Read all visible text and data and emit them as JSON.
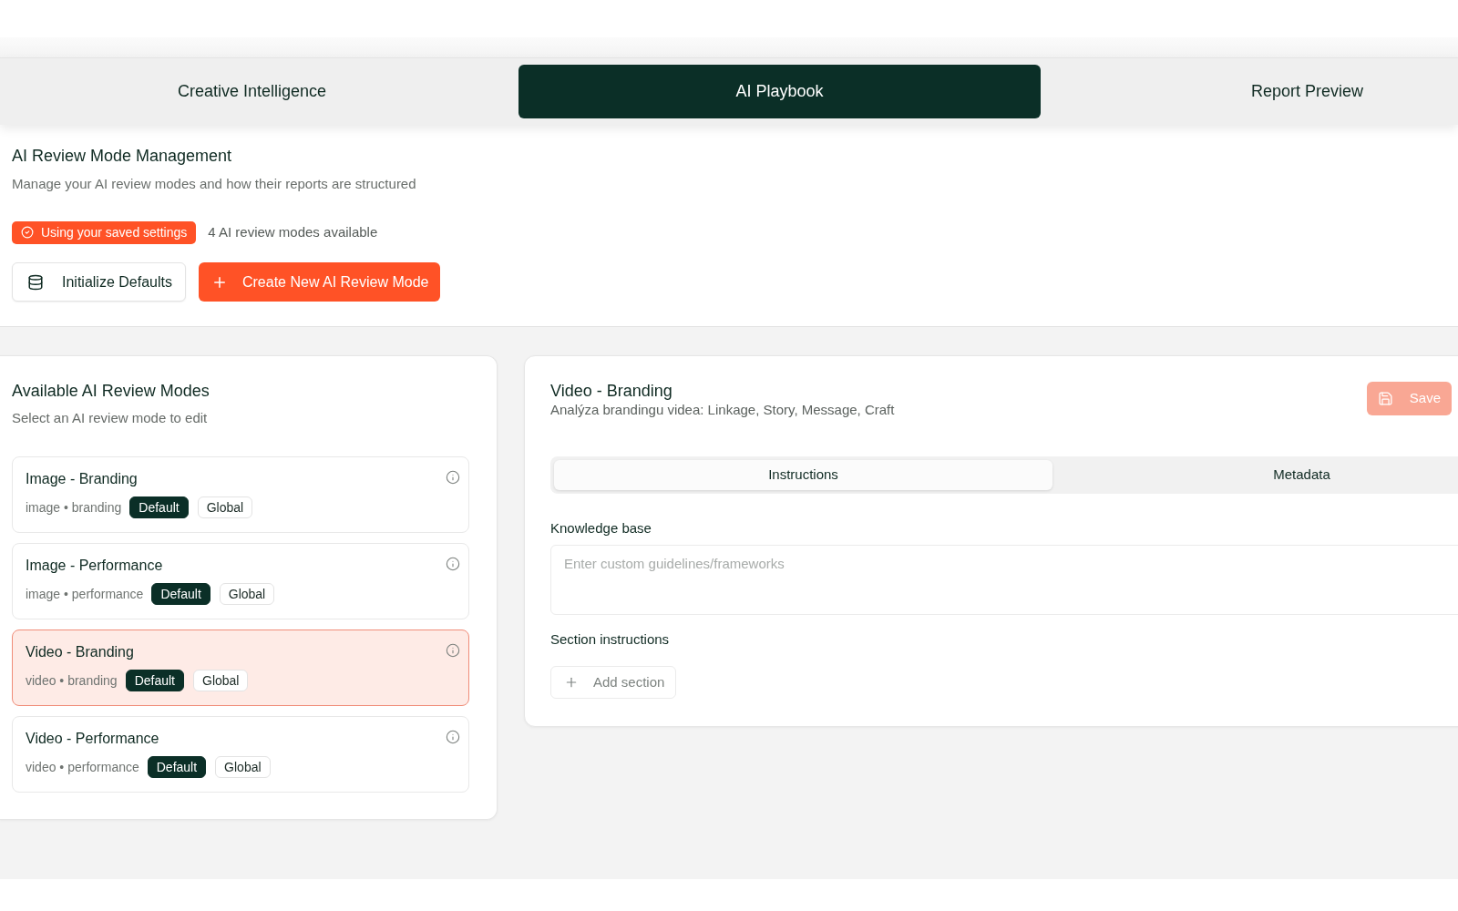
{
  "tabs": [
    {
      "label": "Creative Intelligence",
      "selected": false
    },
    {
      "label": "AI Playbook",
      "selected": true
    },
    {
      "label": "Report Preview",
      "selected": false
    }
  ],
  "header": {
    "title": "AI Review Mode Management",
    "subtitle": "Manage your AI review modes and how their reports are structured",
    "status_badge": "Using your saved settings",
    "mode_count": "4 AI review modes available",
    "buttons": [
      {
        "label": "Initialize Defaults",
        "kind": "secondary"
      },
      {
        "label": "Create New AI Review Mode",
        "kind": "primary"
      }
    ]
  },
  "modes_panel": {
    "title": "Available AI Review Modes",
    "subtitle": "Select an AI review mode to edit",
    "modes": [
      {
        "name": "Image - Branding",
        "meta": "image • branding",
        "selected": false,
        "badges": [
          {
            "label": "Default",
            "kind": "filled"
          },
          {
            "label": "Global",
            "kind": "outlined"
          }
        ]
      },
      {
        "name": "Image - Performance",
        "meta": "image • performance",
        "selected": false,
        "badges": [
          {
            "label": "Default",
            "kind": "filled"
          },
          {
            "label": "Global",
            "kind": "outlined"
          }
        ]
      },
      {
        "name": "Video - Branding",
        "meta": "video • branding",
        "selected": true,
        "badges": [
          {
            "label": "Default",
            "kind": "filled"
          },
          {
            "label": "Global",
            "kind": "outlined"
          }
        ]
      },
      {
        "name": "Video - Performance",
        "meta": "video • performance",
        "selected": false,
        "badges": [
          {
            "label": "Default",
            "kind": "filled"
          },
          {
            "label": "Global",
            "kind": "outlined"
          }
        ]
      }
    ]
  },
  "editor": {
    "title": "Video - Branding",
    "description": "Analýza brandingu videa: Linkage, Story, Message, Craft",
    "save_button": {
      "label": "Save",
      "disabled": true
    },
    "tabs": [
      {
        "label": "Instructions",
        "selected": true
      },
      {
        "label": "Metadata",
        "selected": false
      }
    ],
    "knowledge_base": {
      "label": "Knowledge base",
      "placeholder": "Enter custom guidelines/frameworks"
    },
    "section_instructions": {
      "label": "Section instructions",
      "add_button": "Add section"
    }
  }
}
